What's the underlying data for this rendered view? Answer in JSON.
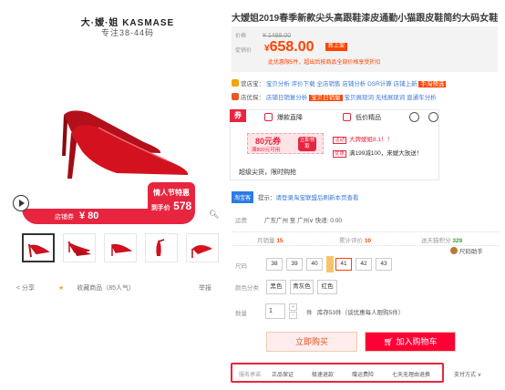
{
  "gallery": {
    "brand": "大·嫒·姐 KASMASE",
    "brand_sub": "专注38-44码",
    "promo_price_label": "店铺券",
    "promo_price_symbol": "¥",
    "promo_price_value": "80",
    "festival_line1": "情人节特惠",
    "festival_line2_symbol": "到手价",
    "festival_line2_value": "578",
    "share": "分享",
    "favorite": "收藏商品（85人气）",
    "report": "举报"
  },
  "product": {
    "title": "大嫒姐2019春季新款尖头高跟鞋漆皮通勤小猫跟皮鞋简约大码女鞋",
    "price_label": "价格",
    "original_price": "¥ 1498.00",
    "promo_label": "促销价",
    "current_price_symbol": "¥",
    "current_price": "658.00",
    "new_badge": "新上架",
    "price_note": "此优惠限5件，超出后按商品全部价格享受折扣",
    "tmall_line": {
      "prefix": "营店宝：",
      "items": [
        "宝贝分析",
        "评价下载",
        "全店销售",
        "店铺分析",
        "DSR计算",
        "店铺上新"
      ],
      "tag": "手淘预选"
    },
    "insight_line": {
      "prefix": "店优探：",
      "items": [
        "店铺日销复分析",
        "宝贝日销量",
        "宝贝展现词",
        "无线展现词",
        "直通车分析"
      ]
    }
  },
  "shop": {
    "logo": "券",
    "tab1": "爆款直降",
    "tab2": "低价精品",
    "coupon_value": "80元券",
    "coupon_sub": "满800元可用",
    "coupon_btn": "立即领取",
    "info1_tag": "活动",
    "info1_text": "大牌嫒姐8.1！！",
    "info2_tag": "优惠",
    "info2_text": "满199减100，来嫒大放送！",
    "slogan": "超级尖货，限时购抢"
  },
  "taobao": {
    "tag": "淘宝客",
    "hint_prefix": "提示：",
    "hint_link": "请登录淘宝联盟后刷新本页查看"
  },
  "delivery": {
    "label": "运费",
    "value": "广东广州 至 广州∨ 快递: 0.00"
  },
  "stats": {
    "monthly_label": "月销量",
    "monthly_value": "15",
    "reviews_label": "累计评价",
    "reviews_value": "10",
    "points_label": "送天猫积分",
    "points_value": "329",
    "size_helper": "尺码助手"
  },
  "size": {
    "label": "尺码",
    "options": [
      "38",
      "39",
      "40",
      "41",
      "42",
      "43"
    ],
    "selected_index": 3
  },
  "color": {
    "label": "颜色分类",
    "options": [
      "黑色",
      "青灰色",
      "红色"
    ]
  },
  "quantity": {
    "label": "数量",
    "value": "1",
    "unit": "件",
    "stock": "库存53件（谈优惠每人限购5件）"
  },
  "actions": {
    "buy": "立即购买",
    "cart": "加入购物车"
  },
  "promise": {
    "label": "服务承诺",
    "items": [
      "正品保证",
      "极速退款",
      "赠运费险",
      "七天无理由退换"
    ],
    "pay": "支付方式"
  },
  "colors": {
    "accent_red": "#e8253f",
    "tmall_orange": "#ff4400",
    "link_blue": "#3c78d8"
  }
}
